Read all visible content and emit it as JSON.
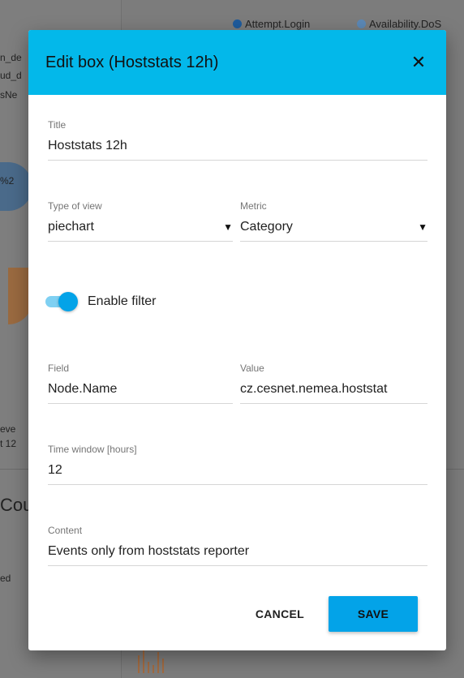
{
  "background": {
    "legend": [
      {
        "label": "Attempt.Login",
        "color": "#1e5b9c"
      },
      {
        "label": "Availability.DoS",
        "color": "#5b88b6"
      }
    ],
    "side_texts": [
      "n_de",
      "ud_d",
      "sNe",
      "%2",
      "eve",
      "t 12",
      "ed"
    ],
    "big_text": "Cou"
  },
  "dialog": {
    "title": "Edit box (Hoststats 12h)",
    "close_icon": "close-icon",
    "fields": {
      "title": {
        "label": "Title",
        "value": "Hoststats 12h"
      },
      "type_of_view": {
        "label": "Type of view",
        "value": "piechart"
      },
      "metric": {
        "label": "Metric",
        "value": "Category"
      },
      "field": {
        "label": "Field",
        "value": "Node.Name"
      },
      "value": {
        "label": "Value",
        "value": "cz.cesnet.nemea.hoststat"
      },
      "time_window": {
        "label": "Time window [hours]",
        "value": "12"
      },
      "content": {
        "label": "Content",
        "value": "Events only from hoststats reporter"
      }
    },
    "toggle": {
      "label": "Enable filter",
      "on": true
    },
    "buttons": {
      "cancel": "CANCEL",
      "save": "SAVE"
    },
    "colors": {
      "header": "#03b8ea",
      "accent": "#03a3e8"
    }
  }
}
